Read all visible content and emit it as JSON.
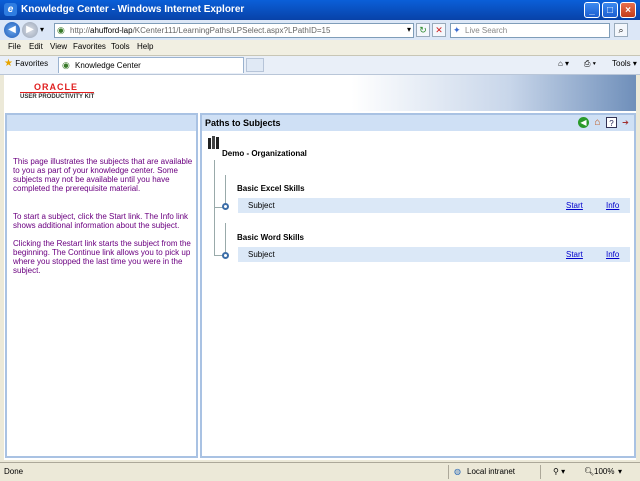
{
  "window": {
    "title": "Knowledge Center - Windows Internet Explorer",
    "minimize": "_",
    "maximize": "□",
    "close": "×"
  },
  "address": {
    "url_prefix": "http://",
    "url_host": "ahufford-lap",
    "url_path": "/KCenter111/LearningPaths/LPSelect.aspx?LPathID=15"
  },
  "search": {
    "placeholder": "Live Search"
  },
  "menu": [
    "File",
    "Edit",
    "View",
    "Favorites",
    "Tools",
    "Help"
  ],
  "favorites": {
    "label": "Favorites",
    "tab_label": "Knowledge Center",
    "tools_label": "Tools"
  },
  "banner": {
    "logo": "ORACLE",
    "subtitle": "USER PRODUCTIVITY KIT"
  },
  "left_pane": {
    "paragraphs": [
      "This page illustrates the subjects that are available to you as part of your knowledge center. Some subjects may not be available until you have completed the prerequisite material.",
      "To start a subject, click the Start link. The Info link shows additional information about the subject.",
      "Clicking the Restart link starts the subject from the beginning. The Continue link allows you to pick up where you stopped the last time you were in the subject."
    ]
  },
  "right_pane": {
    "title": "Paths to Subjects",
    "root": "Demo - Organizational",
    "groups": [
      {
        "label": "Basic Excel Skills",
        "subject": "Subject",
        "start": "Start",
        "info": "Info"
      },
      {
        "label": "Basic Word Skills",
        "subject": "Subject",
        "start": "Start",
        "info": "Info"
      }
    ]
  },
  "status": {
    "left": "Done",
    "zone": "Local intranet",
    "zoom": "100%"
  },
  "colors": {
    "titlebar": "#0a5fd8",
    "pane_header": "#cfe0f5",
    "row_bg": "#dbe8f7",
    "help_text": "#6b0080",
    "link": "#0000cc"
  }
}
